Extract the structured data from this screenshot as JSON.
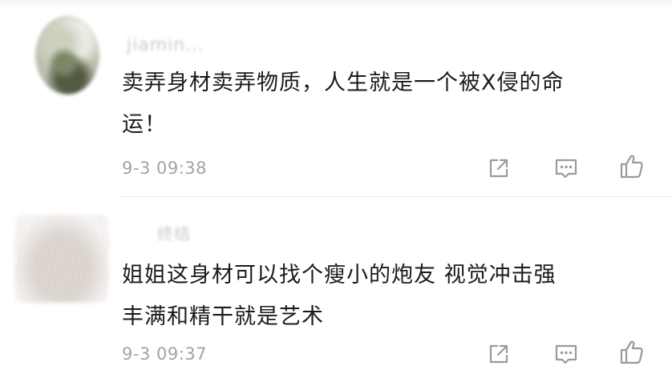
{
  "comments": [
    {
      "username": "jiamin...",
      "text_line1": "卖弄身材卖弄物质，人生就是一个被X侵的命",
      "text_line2": "运！",
      "time": "9-3 09:38"
    },
    {
      "username": "终结",
      "text_line1": "姐姐这身材可以找个瘦小的炮友 视觉冲击强",
      "text_line2": "丰满和精干就是艺术",
      "time": "9-3 09:37"
    }
  ],
  "icons": {
    "share": "share-icon",
    "reply": "reply-icon",
    "like": "like-icon"
  },
  "colors": {
    "text": "#1b1b1b",
    "meta": "#a3a3a3",
    "icon": "#9a9a9a"
  }
}
